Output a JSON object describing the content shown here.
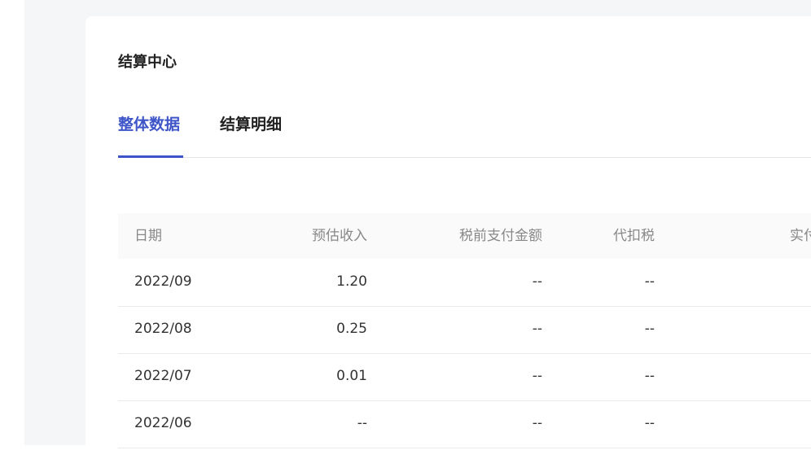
{
  "page_title": "结算中心",
  "tabs": [
    {
      "label": "整体数据",
      "active": true
    },
    {
      "label": "结算明细",
      "active": false
    }
  ],
  "table": {
    "headers": [
      "日期",
      "预估收入",
      "税前支付金额",
      "代扣税",
      "实付"
    ],
    "rows": [
      [
        "2022/09",
        "1.20",
        "--",
        "--"
      ],
      [
        "2022/08",
        "0.25",
        "--",
        "--"
      ],
      [
        "2022/07",
        "0.01",
        "--",
        "--"
      ],
      [
        "2022/06",
        "--",
        "--",
        "--"
      ]
    ]
  },
  "colors": {
    "accent": "#3d55c8"
  }
}
